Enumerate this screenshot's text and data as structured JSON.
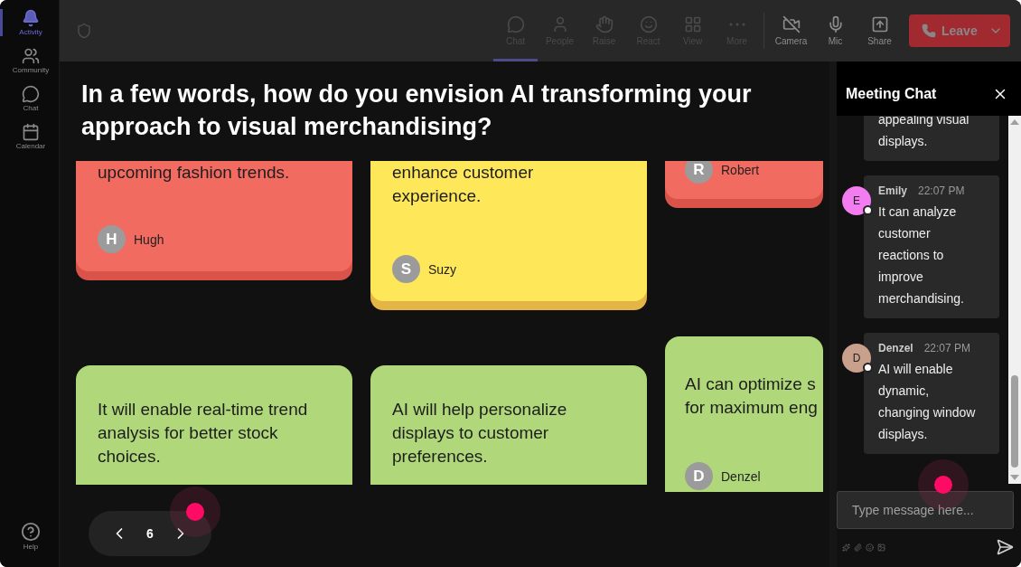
{
  "sidebar": {
    "items": [
      {
        "label": "Activity",
        "selected": true
      },
      {
        "label": "Community",
        "selected": false
      },
      {
        "label": "Chat",
        "selected": false
      },
      {
        "label": "Calendar",
        "selected": false
      }
    ],
    "help": "Help"
  },
  "toolbar": {
    "items": [
      {
        "label": "Chat",
        "kind": "chat",
        "selected": true
      },
      {
        "label": "People",
        "kind": "people",
        "selected": false
      },
      {
        "label": "Raise",
        "kind": "hand",
        "selected": false
      },
      {
        "label": "React",
        "kind": "smile",
        "selected": false
      },
      {
        "label": "View",
        "kind": "grid",
        "selected": false
      },
      {
        "label": "More",
        "kind": "more",
        "selected": false
      }
    ],
    "devices": [
      {
        "label": "Camera",
        "kind": "camera"
      },
      {
        "label": "Mic",
        "kind": "mic"
      },
      {
        "label": "Share",
        "kind": "share"
      }
    ],
    "leave": "Leave"
  },
  "question": "In a few words, how do you envision AI transforming your approach to visual merchandising?",
  "columns": [
    [
      {
        "color": "#f26b60",
        "lines": [
          "upcoming fashion trends."
        ],
        "author": "Hugh",
        "initial": "H"
      },
      {
        "color": "#b0d87a",
        "lines": [
          "It will enable real-time trend",
          "analysis for better stock",
          "choices."
        ]
      }
    ],
    [
      {
        "color": "#ffe75a",
        "lines": [
          "enhance customer",
          "experience."
        ],
        "author": "Suzy",
        "initial": "S"
      },
      {
        "color": "#b0d87a",
        "lines": [
          "AI will help personalize",
          "displays to customer",
          "preferences."
        ]
      }
    ],
    [
      {
        "color": "#f26b60",
        "author": "Robert",
        "initial": "R"
      },
      {
        "color": "#b0d87a",
        "lines": [
          "AI can optimize s",
          "for maximum eng"
        ],
        "author": "Denzel",
        "initial": "D"
      }
    ]
  ],
  "pager": {
    "page": "6"
  },
  "chat": {
    "title": "Meeting Chat",
    "messages": [
      {
        "lines": [
          "appealing visual",
          "displays."
        ]
      },
      {
        "author": "Emily",
        "initial": "E",
        "color": "#f27cf0",
        "time": "22:07 PM",
        "lines": [
          "It can analyze",
          "customer",
          "reactions to",
          "improve",
          "merchandising."
        ]
      },
      {
        "author": "Denzel",
        "initial": "D",
        "color": "#c9a08c",
        "time": "22:07 PM",
        "lines": [
          "AI will enable",
          "dynamic,",
          "changing window",
          "displays."
        ]
      }
    ],
    "placeholder": "Type message here..."
  }
}
